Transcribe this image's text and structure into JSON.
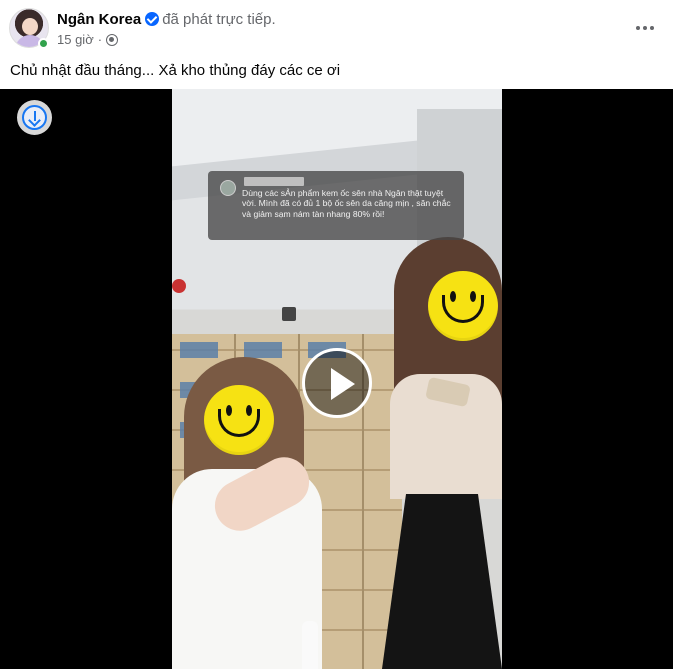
{
  "post": {
    "author": "Ngân Korea",
    "action": "đã phát trực tiếp.",
    "time": "15 giờ",
    "separator": "·",
    "caption": "Chủ nhật đầu tháng... Xả kho thủng đáy các ce ơi",
    "audience_icon": "globe-icon",
    "verified_icon": "verified-badge-icon",
    "more_icon": "more-options-icon"
  },
  "video": {
    "comment_text": "Dùng các sẢn phẩm kem ốc sên nhà Ngân  thật tuyệt vời. Mình đã  có đủ 1 bộ ốc sên  da căng mịn ,  săn chắc và giảm sạm nám tàn nhang 80% rồi!",
    "download_icon": "download-icon",
    "play_icon": "play-icon",
    "face_cover_icon": "smiley-face-icon"
  },
  "colors": {
    "accent": "#0866ff",
    "secondary_text": "#65676b",
    "online": "#31a24c",
    "video_bg": "#000000"
  }
}
